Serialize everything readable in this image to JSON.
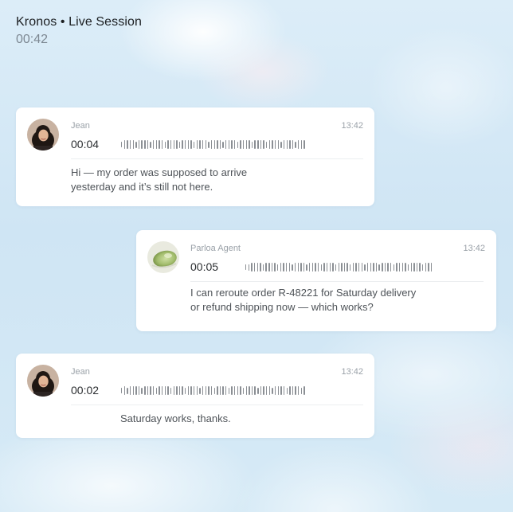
{
  "session": {
    "title": "Kronos • Live Session",
    "elapsed": "00:42"
  },
  "messages": [
    {
      "sender": "Jean",
      "time": "13:42",
      "duration": "00:04",
      "text_lines": [
        "Hi — my order was supposed to arrive",
        "yesterday and it’s still not here."
      ],
      "avatar": "jean-avatar"
    },
    {
      "sender": "Parloa Agent",
      "time": "13:42",
      "duration": "00:05",
      "text_lines": [
        "I can reroute order R-48221 for Saturday delivery",
        "or refund shipping now — which works?"
      ],
      "avatar": "parloa-agent-avatar"
    },
    {
      "sender": "Jean",
      "time": "13:42",
      "duration": "00:02",
      "text_lines": [
        "Saturday works, thanks."
      ],
      "avatar": "jean-avatar"
    }
  ],
  "colors": {
    "background": "#d3e9f6",
    "card": "#ffffff",
    "waveform": "#8b8f94"
  }
}
